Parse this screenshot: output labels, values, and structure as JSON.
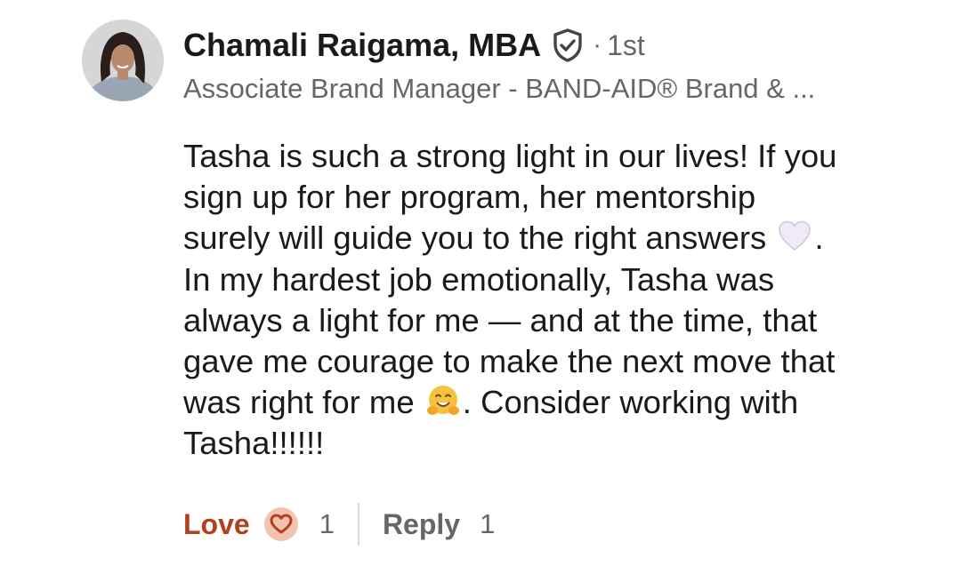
{
  "comment": {
    "author": {
      "name": "Chamali Raigama, MBA",
      "separator": "·",
      "degree": "1st",
      "headline": "Associate Brand Manager - BAND-AID® Brand & ...",
      "avatar_icon": "profile-photo",
      "verified_icon": "verified-shield-icon"
    },
    "text_lines": [
      "Tasha is such a strong light in our lives! If you",
      "sign up for her program, her mentorship",
      "surely will guide you to the right answers",
      "In my hardest job emotionally, Tasha was",
      "always a light for me — and at the time, that",
      "gave me courage to make the next move that",
      "was right for me",
      "Consider working with",
      "Tasha!!!!!!"
    ],
    "line3_suffix": ".",
    "line7_suffix": ".",
    "emojis": {
      "line3": "white-heart-emoji",
      "line7": "hugging-face-emoji"
    },
    "actions": {
      "love_label": "Love",
      "love_count": "1",
      "reply_label": "Reply",
      "reply_count": "1"
    },
    "colors": {
      "love": "#b24020",
      "muted": "#666666",
      "text": "#1a1a1a"
    }
  }
}
